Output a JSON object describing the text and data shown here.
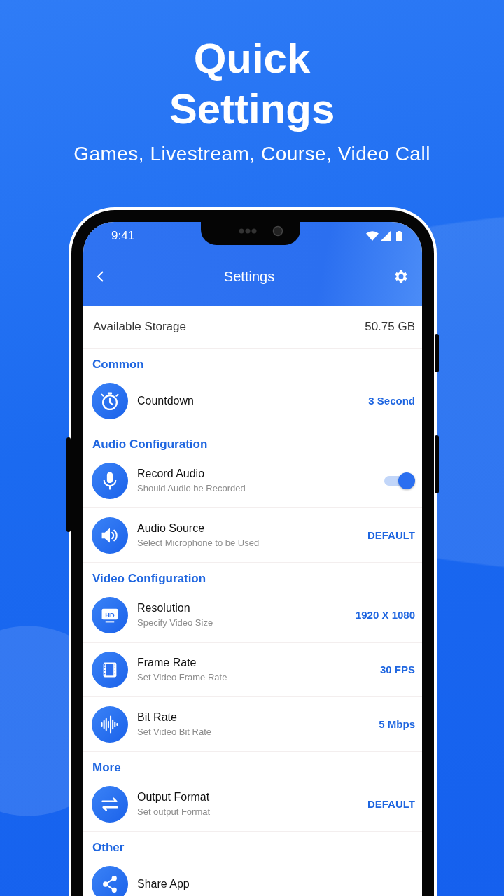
{
  "headline": {
    "title_lines": [
      "Quick",
      "Settings"
    ],
    "subtitle": "Games, Livestream, Course, Video Call"
  },
  "status_bar": {
    "time": "9:41"
  },
  "app_bar": {
    "title": "Settings"
  },
  "storage": {
    "label": "Available Storage",
    "value": "50.75 GB"
  },
  "sections": [
    {
      "title": "Common",
      "items": [
        {
          "kind": "value",
          "title": "Countdown",
          "value": "3 Second"
        }
      ]
    },
    {
      "title": "Audio Configuration",
      "items": [
        {
          "kind": "toggle",
          "title": "Record Audio",
          "subtitle": "Should Audio be Recorded",
          "on": true
        },
        {
          "kind": "value",
          "title": "Audio Source",
          "subtitle": "Select Microphone to be Used",
          "value": "DEFAULT"
        }
      ]
    },
    {
      "title": "Video Configuration",
      "items": [
        {
          "kind": "value",
          "title": "Resolution",
          "subtitle": "Specify Video Size",
          "value": "1920 X 1080",
          "icon_text": "HD"
        },
        {
          "kind": "value",
          "title": "Frame Rate",
          "subtitle": "Set Video Frame Rate",
          "value": "30 FPS"
        },
        {
          "kind": "value",
          "title": "Bit Rate",
          "subtitle": "Set Video Bit Rate",
          "value": "5 Mbps"
        }
      ]
    },
    {
      "title": "More",
      "items": [
        {
          "kind": "value",
          "title": "Output Format",
          "subtitle": "Set output Format",
          "value": "DEFAULT"
        }
      ]
    },
    {
      "title": "Other",
      "items": [
        {
          "kind": "value",
          "title": "Share App"
        }
      ]
    }
  ]
}
